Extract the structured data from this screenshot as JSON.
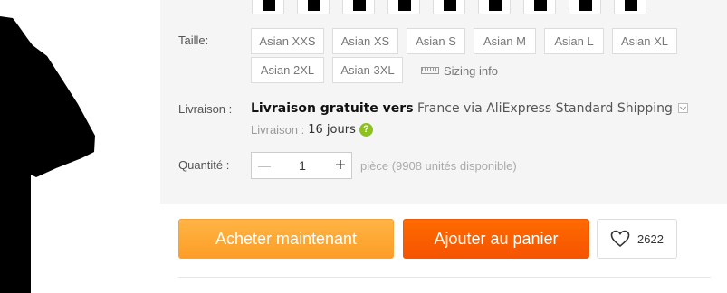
{
  "product": {
    "color_swatch_count": 9,
    "shirt_color": "#000000"
  },
  "size": {
    "label": "Taille:",
    "options": [
      "Asian XXS",
      "Asian XS",
      "Asian S",
      "Asian M",
      "Asian L",
      "Asian XL",
      "Asian 2XL",
      "Asian 3XL"
    ],
    "sizing_info": "Sizing info"
  },
  "shipping": {
    "label": "Livraison :",
    "free_text": "Livraison gratuite vers",
    "via_text": "France via AliExpress Standard Shipping",
    "eta_label": "Livraison :",
    "eta_value": "16 jours",
    "help_glyph": "?"
  },
  "quantity": {
    "label": "Quantité :",
    "minus": "—",
    "plus": "+",
    "value": "1",
    "availability": "pièce (9908 unités disponible)"
  },
  "actions": {
    "buy_now": "Acheter maintenant",
    "add_to_cart": "Ajouter au panier",
    "wishlist_count": "2622"
  },
  "colors": {
    "buy_now": "#fca530",
    "add_to_cart": "#f96000",
    "help_badge": "#8bc220",
    "panel_bg": "#f5f5f5"
  }
}
